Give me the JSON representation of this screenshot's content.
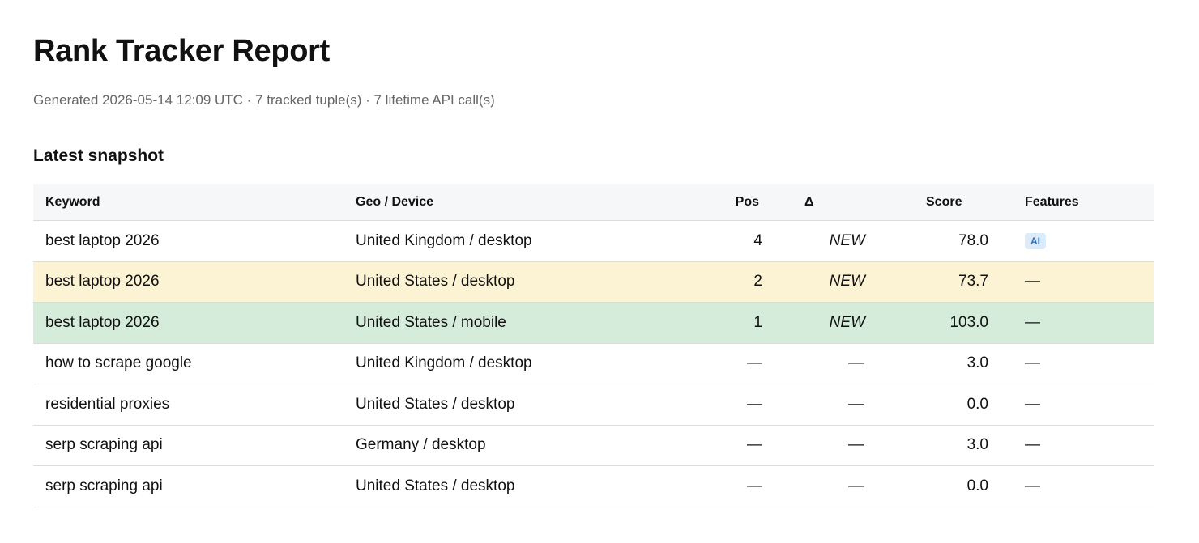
{
  "page": {
    "title": "Rank Tracker Report",
    "meta": "Generated 2026-05-14 12:09 UTC · 7 tracked tuple(s) · 7 lifetime API call(s)",
    "section_title": "Latest snapshot"
  },
  "table": {
    "headers": {
      "keyword": "Keyword",
      "geo_device": "Geo / Device",
      "pos": "Pos",
      "delta": "Δ",
      "score": "Score",
      "features": "Features"
    },
    "rows": [
      {
        "keyword": "best laptop 2026",
        "geo_device": "United Kingdom / desktop",
        "pos": "4",
        "delta": "NEW",
        "score": "78.0",
        "features": "AI",
        "highlight": "none"
      },
      {
        "keyword": "best laptop 2026",
        "geo_device": "United States / desktop",
        "pos": "2",
        "delta": "NEW",
        "score": "73.7",
        "features": "—",
        "highlight": "warn"
      },
      {
        "keyword": "best laptop 2026",
        "geo_device": "United States / mobile",
        "pos": "1",
        "delta": "NEW",
        "score": "103.0",
        "features": "—",
        "highlight": "good"
      },
      {
        "keyword": "how to scrape google",
        "geo_device": "United Kingdom / desktop",
        "pos": "—",
        "delta": "—",
        "score": "3.0",
        "features": "—",
        "highlight": "none"
      },
      {
        "keyword": "residential proxies",
        "geo_device": "United States / desktop",
        "pos": "—",
        "delta": "—",
        "score": "0.0",
        "features": "—",
        "highlight": "none"
      },
      {
        "keyword": "serp scraping api",
        "geo_device": "Germany / desktop",
        "pos": "—",
        "delta": "—",
        "score": "3.0",
        "features": "—",
        "highlight": "none"
      },
      {
        "keyword": "serp scraping api",
        "geo_device": "United States / desktop",
        "pos": "—",
        "delta": "—",
        "score": "0.0",
        "features": "—",
        "highlight": "none"
      }
    ]
  },
  "colors": {
    "warn_row": "#fcf3d4",
    "good_row": "#d4ecd9",
    "header_bg": "#f6f7f9",
    "badge_bg": "#dcebfa",
    "badge_text": "#2f6fb5"
  }
}
